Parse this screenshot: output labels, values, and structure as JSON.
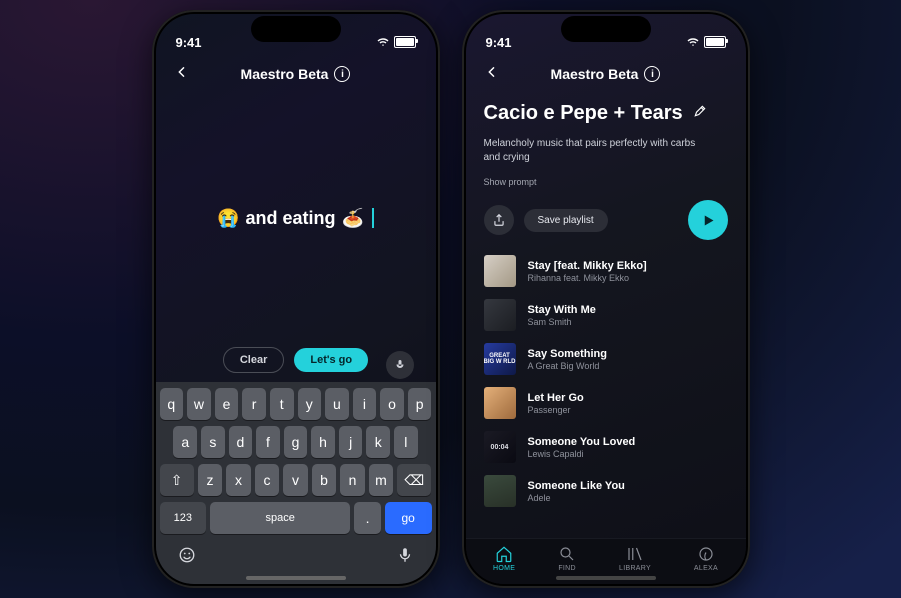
{
  "status_time": "9:41",
  "header": {
    "title": "Maestro Beta",
    "info_glyph": "i"
  },
  "left": {
    "prompt_pre_emoji": "😭",
    "prompt_text": "and eating",
    "prompt_post_emoji": "🍝",
    "clear_label": "Clear",
    "go_label": "Let's go",
    "kbd_row1": [
      "q",
      "w",
      "e",
      "r",
      "t",
      "y",
      "u",
      "i",
      "o",
      "p"
    ],
    "kbd_row2": [
      "a",
      "s",
      "d",
      "f",
      "g",
      "h",
      "j",
      "k",
      "l"
    ],
    "kbd_row3_shift": "⇧",
    "kbd_row3": [
      "z",
      "x",
      "c",
      "v",
      "b",
      "n",
      "m"
    ],
    "kbd_row3_del": "⌫",
    "kbd_123": "123",
    "kbd_space": "space",
    "kbd_punct": ".",
    "kbd_go": "go"
  },
  "right": {
    "playlist_title": "Cacio e Pepe + Tears",
    "playlist_desc": "Melancholy music that pairs perfectly with carbs and crying",
    "show_prompt": "Show prompt",
    "save_label": "Save playlist",
    "art3_label": "GREAT\nBIG\nW RLD",
    "art5_label": "00:04",
    "tracks": [
      {
        "title": "Stay [feat. Mikky Ekko]",
        "artist": "Rihanna feat. Mikky Ekko"
      },
      {
        "title": "Stay With Me",
        "artist": "Sam Smith"
      },
      {
        "title": "Say Something",
        "artist": "A Great Big World"
      },
      {
        "title": "Let Her Go",
        "artist": "Passenger"
      },
      {
        "title": "Someone You Loved",
        "artist": "Lewis Capaldi"
      },
      {
        "title": "Someone Like You",
        "artist": "Adele"
      }
    ],
    "nav": [
      {
        "label": "HOME"
      },
      {
        "label": "FIND"
      },
      {
        "label": "LIBRARY"
      },
      {
        "label": "ALEXA"
      }
    ]
  }
}
